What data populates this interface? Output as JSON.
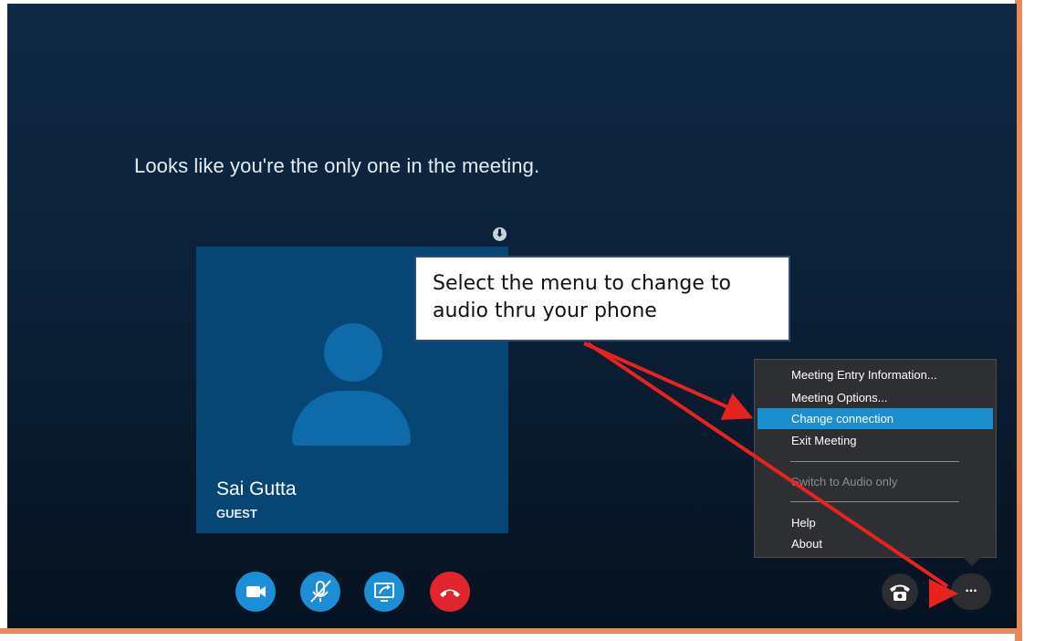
{
  "meeting": {
    "status_message": "Looks like you're the only one in the meeting."
  },
  "participant": {
    "name": "Sai Gutta",
    "role": "GUEST"
  },
  "callout": {
    "text": "Select the menu to change to audio thru your phone"
  },
  "menu": {
    "items": [
      {
        "label": "Meeting Entry Information...",
        "state": "normal"
      },
      {
        "label": "Meeting Options...",
        "state": "normal"
      },
      {
        "label": "Change connection",
        "state": "highlighted"
      },
      {
        "label": "Exit Meeting",
        "state": "normal"
      },
      {
        "label": "Switch to Audio only",
        "state": "disabled"
      },
      {
        "label": "Help",
        "state": "normal"
      },
      {
        "label": "About",
        "state": "normal"
      }
    ]
  },
  "controls": {
    "video": {
      "icon": "video-camera-icon",
      "color": "#1b8ed6"
    },
    "mute": {
      "icon": "microphone-muted-icon",
      "color": "#1b8ed6"
    },
    "share": {
      "icon": "share-screen-icon",
      "color": "#1b8ed6"
    },
    "hangup": {
      "icon": "hang-up-phone-icon",
      "color": "#e0262c"
    },
    "dialpad": {
      "icon": "phone-dialpad-icon",
      "color": "#2b2d30"
    },
    "more": {
      "icon": "ellipsis-icon",
      "label": "...",
      "color": "#2b2d30"
    }
  },
  "colors": {
    "accent": "#1a8fd0",
    "annotation_arrow": "#e8231f",
    "tile_background": "#074575"
  }
}
